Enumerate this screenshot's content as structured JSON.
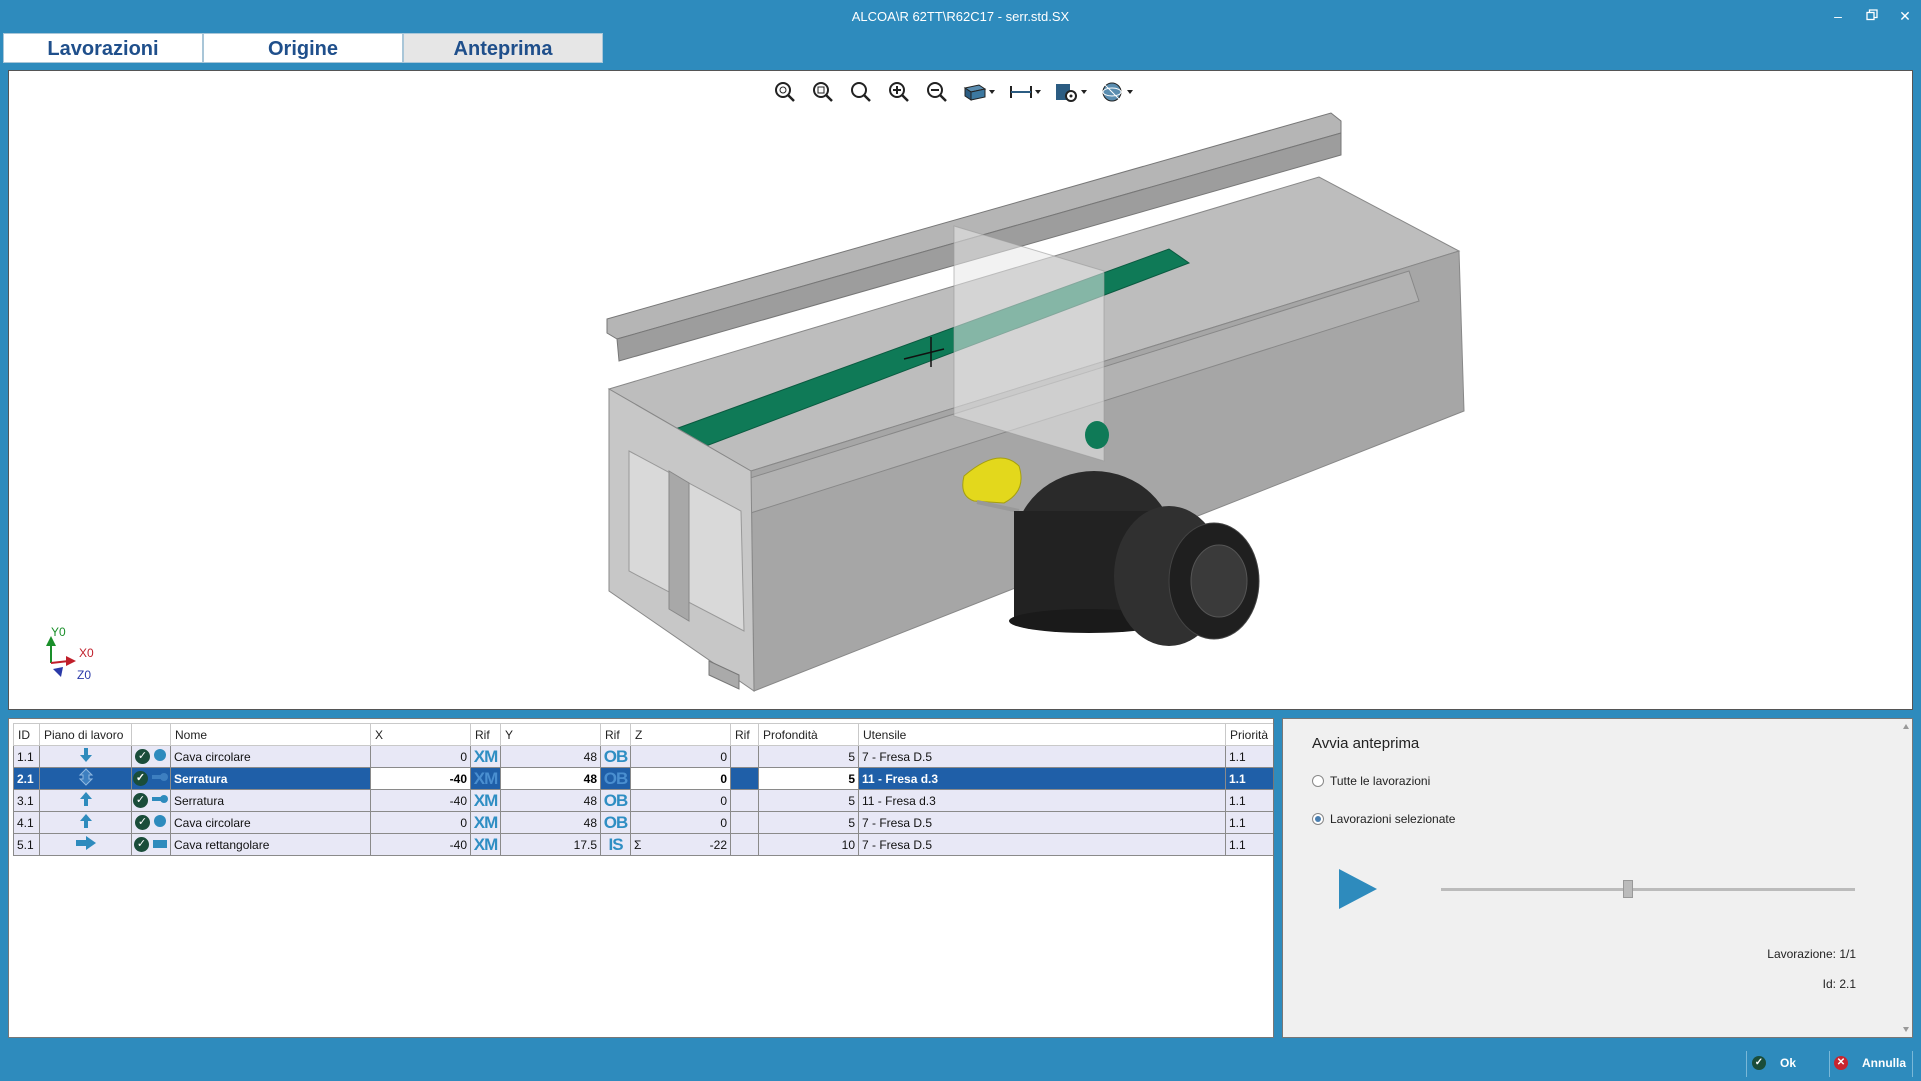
{
  "window": {
    "title": "ALCOA\\R 62TT\\R62C17 - serr.std.SX"
  },
  "tabs": [
    {
      "label": "Lavorazioni"
    },
    {
      "label": "Origine"
    },
    {
      "label": "Anteprima"
    }
  ],
  "active_tab": "Anteprima",
  "toolbar_icons": [
    "zoom-extents-icon",
    "zoom-window-icon",
    "zoom-select-icon",
    "zoom-in-icon",
    "zoom-out-icon",
    "view-cube-icon",
    "measure-icon",
    "settings-icon",
    "render-mode-icon"
  ],
  "axes": {
    "y": "Y0",
    "x": "X0",
    "z": "Z0"
  },
  "table": {
    "columns": [
      "ID",
      "Piano di lavoro",
      "",
      "Nome",
      "X",
      "Rif",
      "Y",
      "Rif",
      "Z",
      "Rif",
      "Profondità",
      "Utensile",
      "Priorità"
    ],
    "rows": [
      {
        "id": "1.1",
        "piano": "arrow-down-icon",
        "shape": "circle-icon",
        "nome": "Cava circolare",
        "x": "0",
        "rif_x": "XM",
        "y": "48",
        "rif_y": "OB",
        "z_sym": "",
        "z": "0",
        "profondita": "5",
        "utensile": "7 - Fresa D.5",
        "priorita": "1.1"
      },
      {
        "id": "2.1",
        "piano": "arrow-diamond-icon",
        "shape": "keyhole-icon",
        "nome": "Serratura",
        "x": "-40",
        "rif_x": "XM",
        "y": "48",
        "rif_y": "OB",
        "z_sym": "",
        "z": "0",
        "profondita": "5",
        "utensile": "11 - Fresa d.3",
        "priorita": "1.1"
      },
      {
        "id": "3.1",
        "piano": "arrow-up-icon",
        "shape": "keyhole-icon",
        "nome": "Serratura",
        "x": "-40",
        "rif_x": "XM",
        "y": "48",
        "rif_y": "OB",
        "z_sym": "",
        "z": "0",
        "profondita": "5",
        "utensile": "11 - Fresa d.3",
        "priorita": "1.1"
      },
      {
        "id": "4.1",
        "piano": "arrow-up-icon",
        "shape": "circle-icon",
        "nome": "Cava circolare",
        "x": "0",
        "rif_x": "XM",
        "y": "48",
        "rif_y": "OB",
        "z_sym": "",
        "z": "0",
        "profondita": "5",
        "utensile": "7 - Fresa D.5",
        "priorita": "1.1"
      },
      {
        "id": "5.1",
        "piano": "arrow-right-icon",
        "shape": "rectangle-icon",
        "nome": "Cava rettangolare",
        "x": "-40",
        "rif_x": "XM",
        "y": "17.5",
        "rif_y": "IS",
        "z_sym": "Σ",
        "z": "-22",
        "profondita": "10",
        "utensile": "7 - Fresa D.5",
        "priorita": "1.1"
      }
    ],
    "selected_row": "2.1"
  },
  "preview": {
    "title": "Avvia anteprima",
    "option_all": "Tutte le lavorazioni",
    "option_selected": "Lavorazioni selezionate",
    "selected_option": "Lavorazioni selezionate",
    "lavorazione": "Lavorazione: 1/1",
    "id": "Id: 2.1"
  },
  "statusbar": {
    "ok_label": "Ok",
    "cancel_label": "Annulla"
  },
  "colors": {
    "accent": "#2e8bbd",
    "selection": "#1f5fa8",
    "green_face": "#0f7a57",
    "yellow_face": "#e3d81c"
  }
}
